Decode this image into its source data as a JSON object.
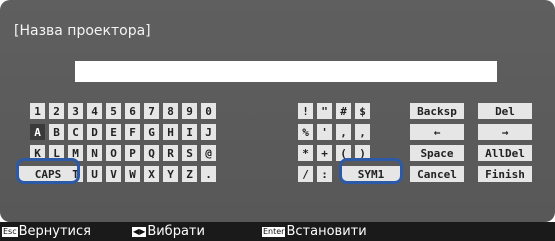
{
  "title": "[Назва проектора]",
  "input": {
    "value": ""
  },
  "keyboard": {
    "digits": [
      "1",
      "2",
      "3",
      "4",
      "5",
      "6",
      "7",
      "8",
      "9",
      "0"
    ],
    "row2": [
      "A",
      "B",
      "C",
      "D",
      "E",
      "F",
      "G",
      "H",
      "I",
      "J"
    ],
    "row3": [
      "K",
      "L",
      "M",
      "N",
      "O",
      "P",
      "Q",
      "R",
      "S",
      "@"
    ],
    "row4": [
      "CAPS",
      "T",
      "U",
      "V",
      "W",
      "X",
      "Y",
      "Z",
      "."
    ],
    "sym": [
      [
        "!",
        "\"",
        "#",
        "$"
      ],
      [
        "%",
        "'",
        ",",
        ","
      ],
      [
        "*",
        "+",
        "(",
        ")"
      ],
      [
        "/",
        ":",
        "SYM1"
      ]
    ],
    "ctrl": [
      [
        "Backsp",
        "Del"
      ],
      [
        "←",
        "→"
      ],
      [
        "Space",
        "AllDel"
      ],
      [
        "Cancel",
        "Finish"
      ]
    ]
  },
  "footer": {
    "back_key": "Esc",
    "back_label": "Вернутися",
    "select_key": "◀▶",
    "select_label": "Вибрати",
    "enter_key": "Enter",
    "enter_label": "Встановити"
  },
  "colors": {
    "panel": "#5f5f5f",
    "highlight": "#2d5aa6"
  }
}
